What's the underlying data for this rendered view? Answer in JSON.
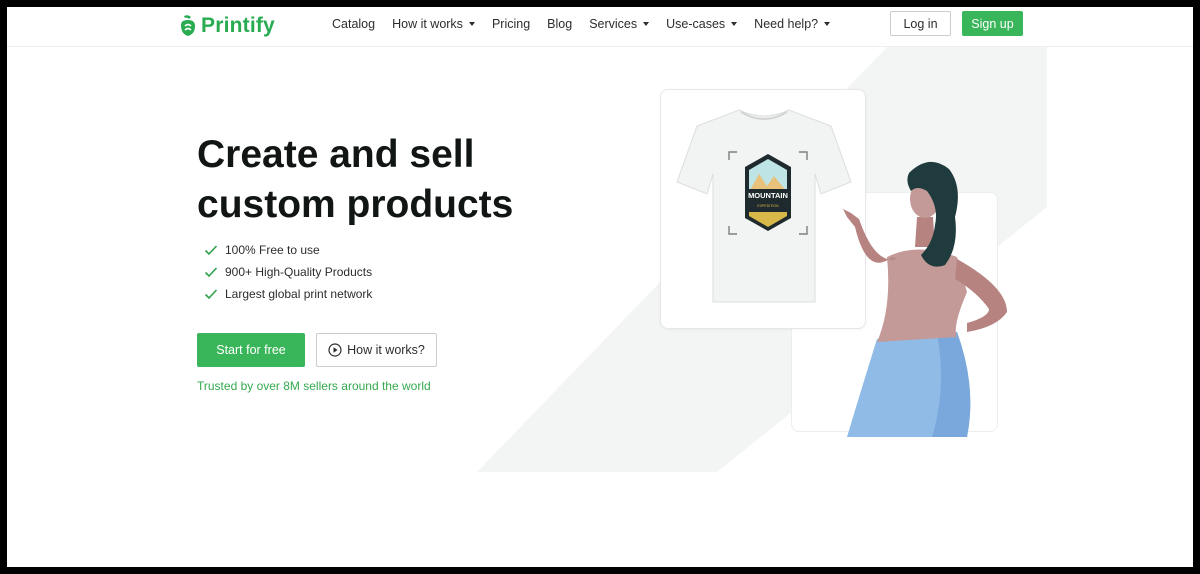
{
  "brand": {
    "name": "Printify",
    "color": "#29ab51"
  },
  "nav": {
    "items": [
      {
        "label": "Catalog",
        "dropdown": false
      },
      {
        "label": "How it works",
        "dropdown": true
      },
      {
        "label": "Pricing",
        "dropdown": false
      },
      {
        "label": "Blog",
        "dropdown": false
      },
      {
        "label": "Services",
        "dropdown": true
      },
      {
        "label": "Use-cases",
        "dropdown": true
      },
      {
        "label": "Need help?",
        "dropdown": true
      }
    ],
    "login_label": "Log in",
    "signup_label": "Sign up"
  },
  "hero": {
    "title_line1": "Create and sell",
    "title_line2": "custom products",
    "features": [
      "100% Free to use",
      "900+ High-Quality Products",
      "Largest global print network"
    ],
    "start_label": "Start for free",
    "how_label": "How it works?",
    "trusted_text": "Trusted by over 8M sellers around the world"
  },
  "illustration": {
    "badge_text": "MOUNTAIN",
    "badge_subtext": "EXPEDITION"
  },
  "colors": {
    "accent": "#39b55a",
    "trusted": "#35a94f",
    "text_dark": "#111614"
  }
}
